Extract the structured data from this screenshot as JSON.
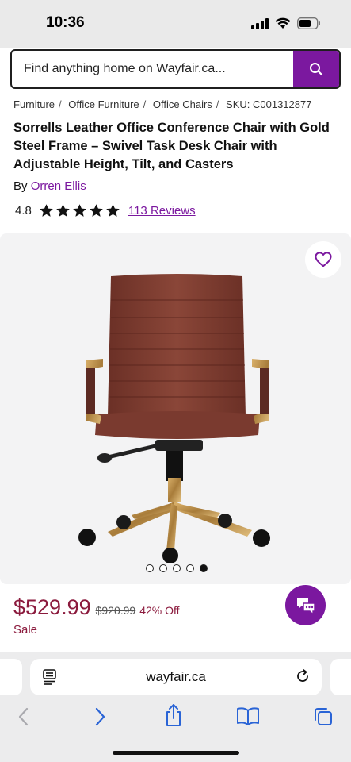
{
  "status_bar": {
    "time": "10:36"
  },
  "search": {
    "placeholder": "Find anything home on Wayfair.ca..."
  },
  "breadcrumb": [
    "Furniture",
    "Office Furniture",
    "Office Chairs",
    "SKU: C001312877"
  ],
  "product": {
    "title": "Sorrells Leather Office Conference Chair with Gold Steel Frame – Swivel Task Desk Chair with Adjustable Height, Tilt, and Casters",
    "by_prefix": "By",
    "brand": "Orren Ellis",
    "rating": "4.8",
    "stars": 5,
    "reviews": "113 Reviews"
  },
  "gallery": {
    "image_count": 5,
    "active_index": 4
  },
  "pricing": {
    "price": "$529.99",
    "original_price": "$920.99",
    "discount": "42% Off",
    "label": "Sale"
  },
  "browser": {
    "url": "wayfair.ca"
  },
  "colors": {
    "brand": "#7b189f",
    "price": "#8b1a3d"
  }
}
